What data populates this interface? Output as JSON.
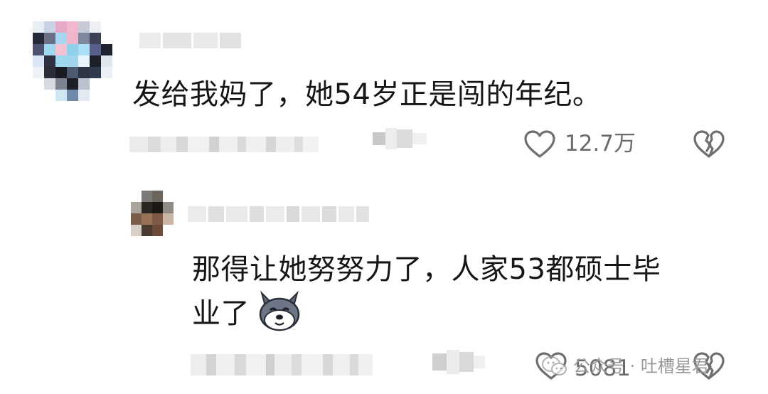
{
  "comments": [
    {
      "text": "发给我妈了，她54岁正是闯的年纪。",
      "like_count": "12.7万",
      "like_icon": "heart-outline-icon",
      "dislike_icon": "broken-heart-icon"
    },
    {
      "text_line1": "那得让她努努力了，人家53都硕士毕",
      "text_line2": "业了",
      "emoji": "husky-dog-emoji",
      "like_count": "5081",
      "like_icon": "heart-outline-icon",
      "dislike_icon": "broken-heart-icon"
    }
  ],
  "watermark": {
    "text": "公众号 · 吐槽星君",
    "icon": "wechat-icon"
  },
  "colors": {
    "text": "#161616",
    "meta": "#6c6c6c",
    "icon": "#6f6f6f"
  }
}
